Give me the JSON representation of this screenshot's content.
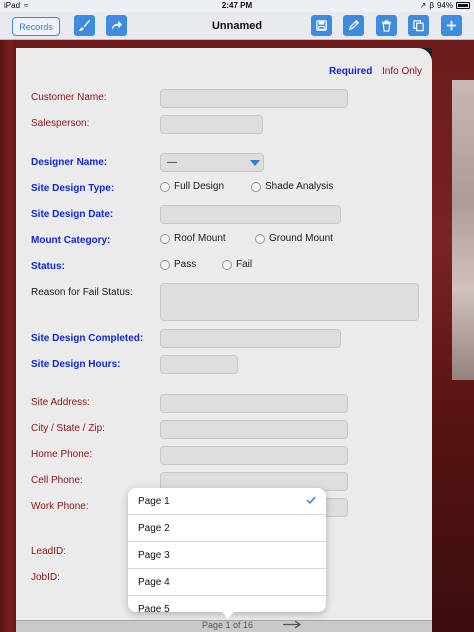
{
  "status_bar": {
    "device": "iPad",
    "time": "2:47 PM",
    "battery": "94%"
  },
  "toolbar": {
    "records_label": "Records",
    "title": "Unnamed"
  },
  "legend": {
    "required": "Required",
    "info_only": "Info Only"
  },
  "form": {
    "customer_name": "Customer Name:",
    "salesperson": "Salesperson:",
    "designer_name": "Designer Name:",
    "designer_value": "—",
    "site_design_type": "Site Design Type:",
    "full_design": "Full Design",
    "shade_analysis": "Shade Analysis",
    "site_design_date": "Site Design Date:",
    "mount_category": "Mount Category:",
    "roof_mount": "Roof Mount",
    "ground_mount": "Ground Mount",
    "status": "Status:",
    "pass": "Pass",
    "fail": "Fail",
    "reason_fail": "Reason for Fail Status:",
    "site_design_completed": "Site Design Completed:",
    "site_design_hours": "Site Design Hours:",
    "site_address": "Site Address:",
    "city_state_zip": "City / State / Zip:",
    "home_phone": "Home Phone:",
    "cell_phone": "Cell Phone:",
    "work_phone": "Work Phone:",
    "lead_id": "LeadID:",
    "job_id": "JobID:"
  },
  "picker": {
    "items": [
      "Page 1",
      "Page 2",
      "Page 3",
      "Page 4",
      "Page 5"
    ],
    "selected": "Page 1"
  },
  "pagebar": {
    "label": "Page 1 of 16"
  },
  "colors": {
    "accent": "#3f8be0",
    "required": "#1226d6",
    "optional": "#8b1414",
    "backdrop": "#7a1f1f"
  }
}
